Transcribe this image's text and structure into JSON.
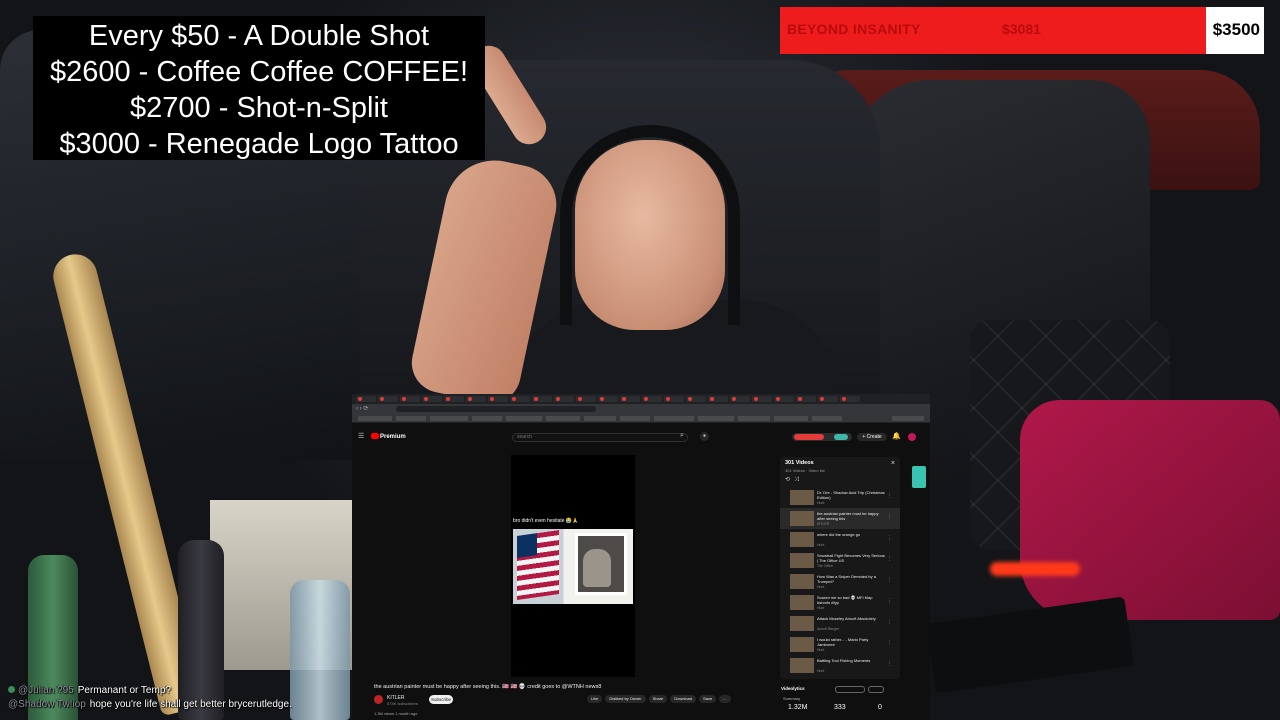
{
  "goals": {
    "lines": [
      "Every $50 - A Double Shot",
      "$2600 - Coffee Coffee COFFEE!",
      "$2700 - Shot-n-Split",
      "$3000 - Renegade Logo Tattoo"
    ]
  },
  "progress_bar": {
    "title": "BEYOND INSANITY",
    "current": "$3081",
    "target": "$3500",
    "fraction": 0.88,
    "fill_color": "#ee1c1c"
  },
  "browser": {
    "youtube": {
      "logo": "Premium",
      "search_placeholder": "search",
      "create_label": "+ Create",
      "short": {
        "caption": "bro didn't even hesitate 😭🙏"
      },
      "video": {
        "title": "the austrian painter must be happy after seeing this. 🇺🇸 🇺🇸 💀 credit goes to @WTNH news8",
        "channel": "KITLER",
        "subscribers": "574K subscribers",
        "subscribe_label": "Subscribe",
        "actions": [
          "Like",
          "Disliked by Owner",
          "Share",
          "Download",
          "Save",
          "..."
        ],
        "description_meta": "1.3M views  1 month ago"
      },
      "playlist": {
        "title": "301 Videos",
        "subtitle": "301 Videos · Video list",
        "items": [
          {
            "title": "Dr. Dre - Shadow Acid Trip (Christmas Edition)",
            "channel": "Hurk"
          },
          {
            "title": "the austrian painter must be happy after seeing this",
            "channel": "KITLER"
          },
          {
            "title": "where did the orange go",
            "channel": "Hurk"
          },
          {
            "title": "Snowball Fight Becomes Very Serious | The Office US",
            "channel": "The Office"
          },
          {
            "title": "How Was a Sniper Demoted by a Trumpet?",
            "channel": "Hurk"
          },
          {
            "title": "Scared me so bad 💀 MFI Map #shorts #fyp",
            "channel": "Hurk"
          },
          {
            "title": "Attack Moseley Airsoft Absolutely",
            "channel": "Airsoft Ranger"
          },
          {
            "title": "I would rather... - Mario Party Jamboree",
            "channel": "Hurk"
          },
          {
            "title": "Battling Tool Fishing Moments",
            "channel": "Hurk"
          }
        ]
      },
      "analytics": {
        "heading": "Videolytics",
        "summary": "Summary",
        "stats": [
          "1.32M",
          "333",
          "0"
        ]
      }
    }
  },
  "chat": [
    {
      "user": "@Julian ?95",
      "text": "Permanant or Temp?"
    },
    {
      "user": "@Shadow Tw!iop",
      "text": "hope you're life shall get better brycerutledge."
    }
  ]
}
